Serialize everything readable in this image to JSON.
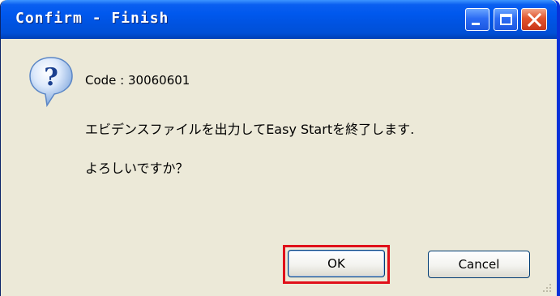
{
  "window": {
    "title": "Confirm - Finish",
    "controls": {
      "minimize": "minimize-icon",
      "maximize": "maximize-icon",
      "close": "close-icon"
    }
  },
  "dialog": {
    "icon": "question-icon",
    "code": "Code : 30060601",
    "message_line1": "エビデンスファイルを出力してEasy Startを終了します.",
    "message_line2": "よろしいですか？"
  },
  "buttons": {
    "ok": "OK",
    "cancel": "Cancel"
  },
  "colors": {
    "titlebar": "#0053e1",
    "dialog_bg": "#ece9d8",
    "highlight": "#e0101a"
  }
}
